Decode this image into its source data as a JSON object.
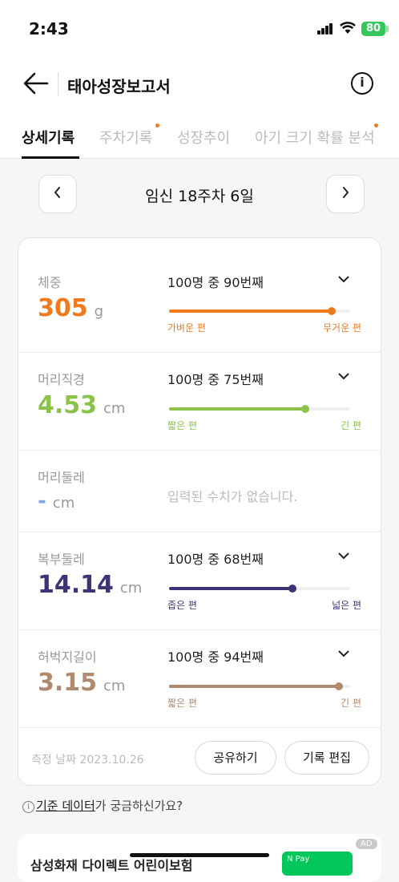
{
  "status": {
    "time": "2:43",
    "battery": "80"
  },
  "header": {
    "title": "태아성장보고서",
    "info_glyph": "i"
  },
  "tabs": [
    {
      "label": "상세기록",
      "active": true
    },
    {
      "label": "주차기록",
      "dot": true
    },
    {
      "label": "성장추이"
    },
    {
      "label": "아기 크기 확률 분석",
      "dot": true
    }
  ],
  "week_nav": {
    "label": "임신 18주차 6일",
    "prev_icon": "chevron-left-icon",
    "next_icon": "chevron-right-icon"
  },
  "metrics": [
    {
      "label": "체중",
      "value": "305",
      "unit": "g",
      "rank": "100명 중 90번째",
      "percent": 0.9,
      "low": "가벼운 편",
      "high": "무거운 편",
      "color": "#f07b1e"
    },
    {
      "label": "머리직경",
      "value": "4.53",
      "unit": "cm",
      "rank": "100명 중 75번째",
      "percent": 0.75,
      "low": "짧은 편",
      "high": "긴 편",
      "color": "#8bc34a"
    },
    {
      "label": "머리둘레",
      "value": "-",
      "unit": "cm",
      "empty": "입력된 수치가 없습니다.",
      "color": "#7aa9e0"
    },
    {
      "label": "복부둘레",
      "value": "14.14",
      "unit": "cm",
      "rank": "100명 중 68번째",
      "percent": 0.68,
      "low": "좁은 편",
      "high": "넓은 편",
      "color": "#3b3475"
    },
    {
      "label": "허벅지길이",
      "value": "3.15",
      "unit": "cm",
      "rank": "100명 중 94번째",
      "percent": 0.94,
      "low": "짧은 편",
      "high": "긴 편",
      "color": "#b08a6e"
    }
  ],
  "footer": {
    "date": "측정 날짜 2023.10.26",
    "share": "공유하기",
    "edit": "기록 편집"
  },
  "standard": {
    "icon": "i",
    "link": "기준 데이터",
    "rest": "가 궁금하신가요?"
  },
  "ad": {
    "text": "삼성화재 다이렉트 어린이보험",
    "badge": "AD",
    "pay": "N Pay"
  }
}
